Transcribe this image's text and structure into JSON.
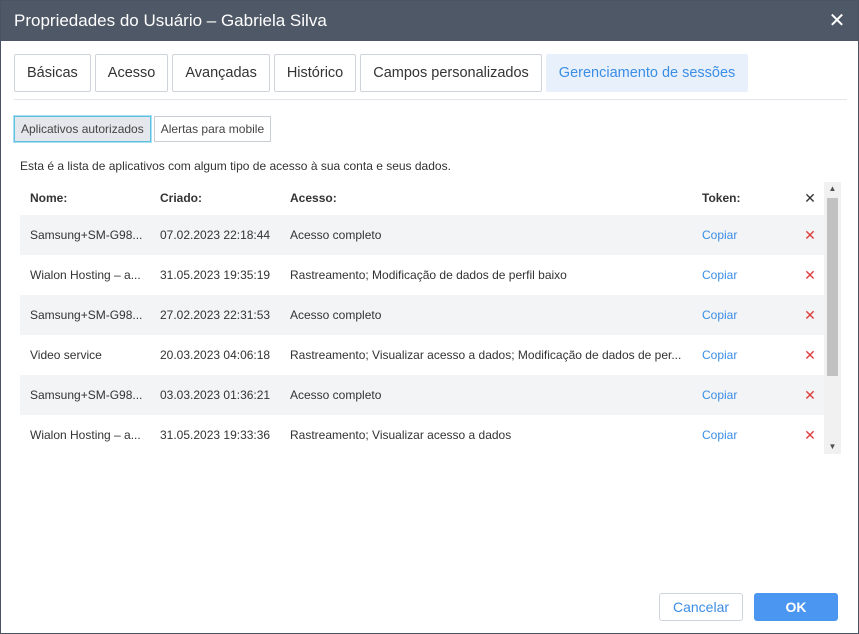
{
  "dialog": {
    "title": "Propriedades do Usuário – Gabriela Silva",
    "close_glyph": "✕"
  },
  "tabs": [
    {
      "label": "Básicas",
      "active": false
    },
    {
      "label": "Acesso",
      "active": false
    },
    {
      "label": "Avançadas",
      "active": false
    },
    {
      "label": "Histórico",
      "active": false
    },
    {
      "label": "Campos personalizados",
      "active": false
    },
    {
      "label": "Gerenciamento de sessões",
      "active": true
    }
  ],
  "subtabs": [
    {
      "label": "Aplicativos autorizados",
      "active": true
    },
    {
      "label": "Alertas para mobile",
      "active": false
    }
  ],
  "description": "Esta é a lista de aplicativos com algum tipo de acesso à sua conta e seus dados.",
  "table": {
    "headers": {
      "name": "Nome:",
      "created": "Criado:",
      "access": "Acesso:",
      "token": "Token:"
    },
    "rows": [
      {
        "name": "Samsung+SM-G98...",
        "created": "07.02.2023 22:18:44",
        "access": "Acesso completo",
        "token": "Copiar"
      },
      {
        "name": "Wialon Hosting – a...",
        "created": "31.05.2023 19:35:19",
        "access": "Rastreamento; Modificação de dados de perfil baixo",
        "token": "Copiar"
      },
      {
        "name": "Samsung+SM-G98...",
        "created": "27.02.2023 22:31:53",
        "access": "Acesso completo",
        "token": "Copiar"
      },
      {
        "name": "Video service",
        "created": "20.03.2023 04:06:18",
        "access": "Rastreamento; Visualizar acesso a dados; Modificação de dados de per...",
        "token": "Copiar"
      },
      {
        "name": "Samsung+SM-G98...",
        "created": "03.03.2023 01:36:21",
        "access": "Acesso completo",
        "token": "Copiar"
      },
      {
        "name": "Wialon Hosting – a...",
        "created": "31.05.2023 19:33:36",
        "access": "Rastreamento; Visualizar acesso a dados",
        "token": "Copiar"
      }
    ]
  },
  "icons": {
    "delete": "✕",
    "scroll_up": "▲",
    "scroll_down": "▼"
  },
  "buttons": {
    "cancel": "Cancelar",
    "ok": "OK"
  },
  "colors": {
    "titlebar": "#4f5866",
    "accent": "#3b8de6",
    "delete": "#e03a3a",
    "ok_button": "#4a96f0"
  }
}
